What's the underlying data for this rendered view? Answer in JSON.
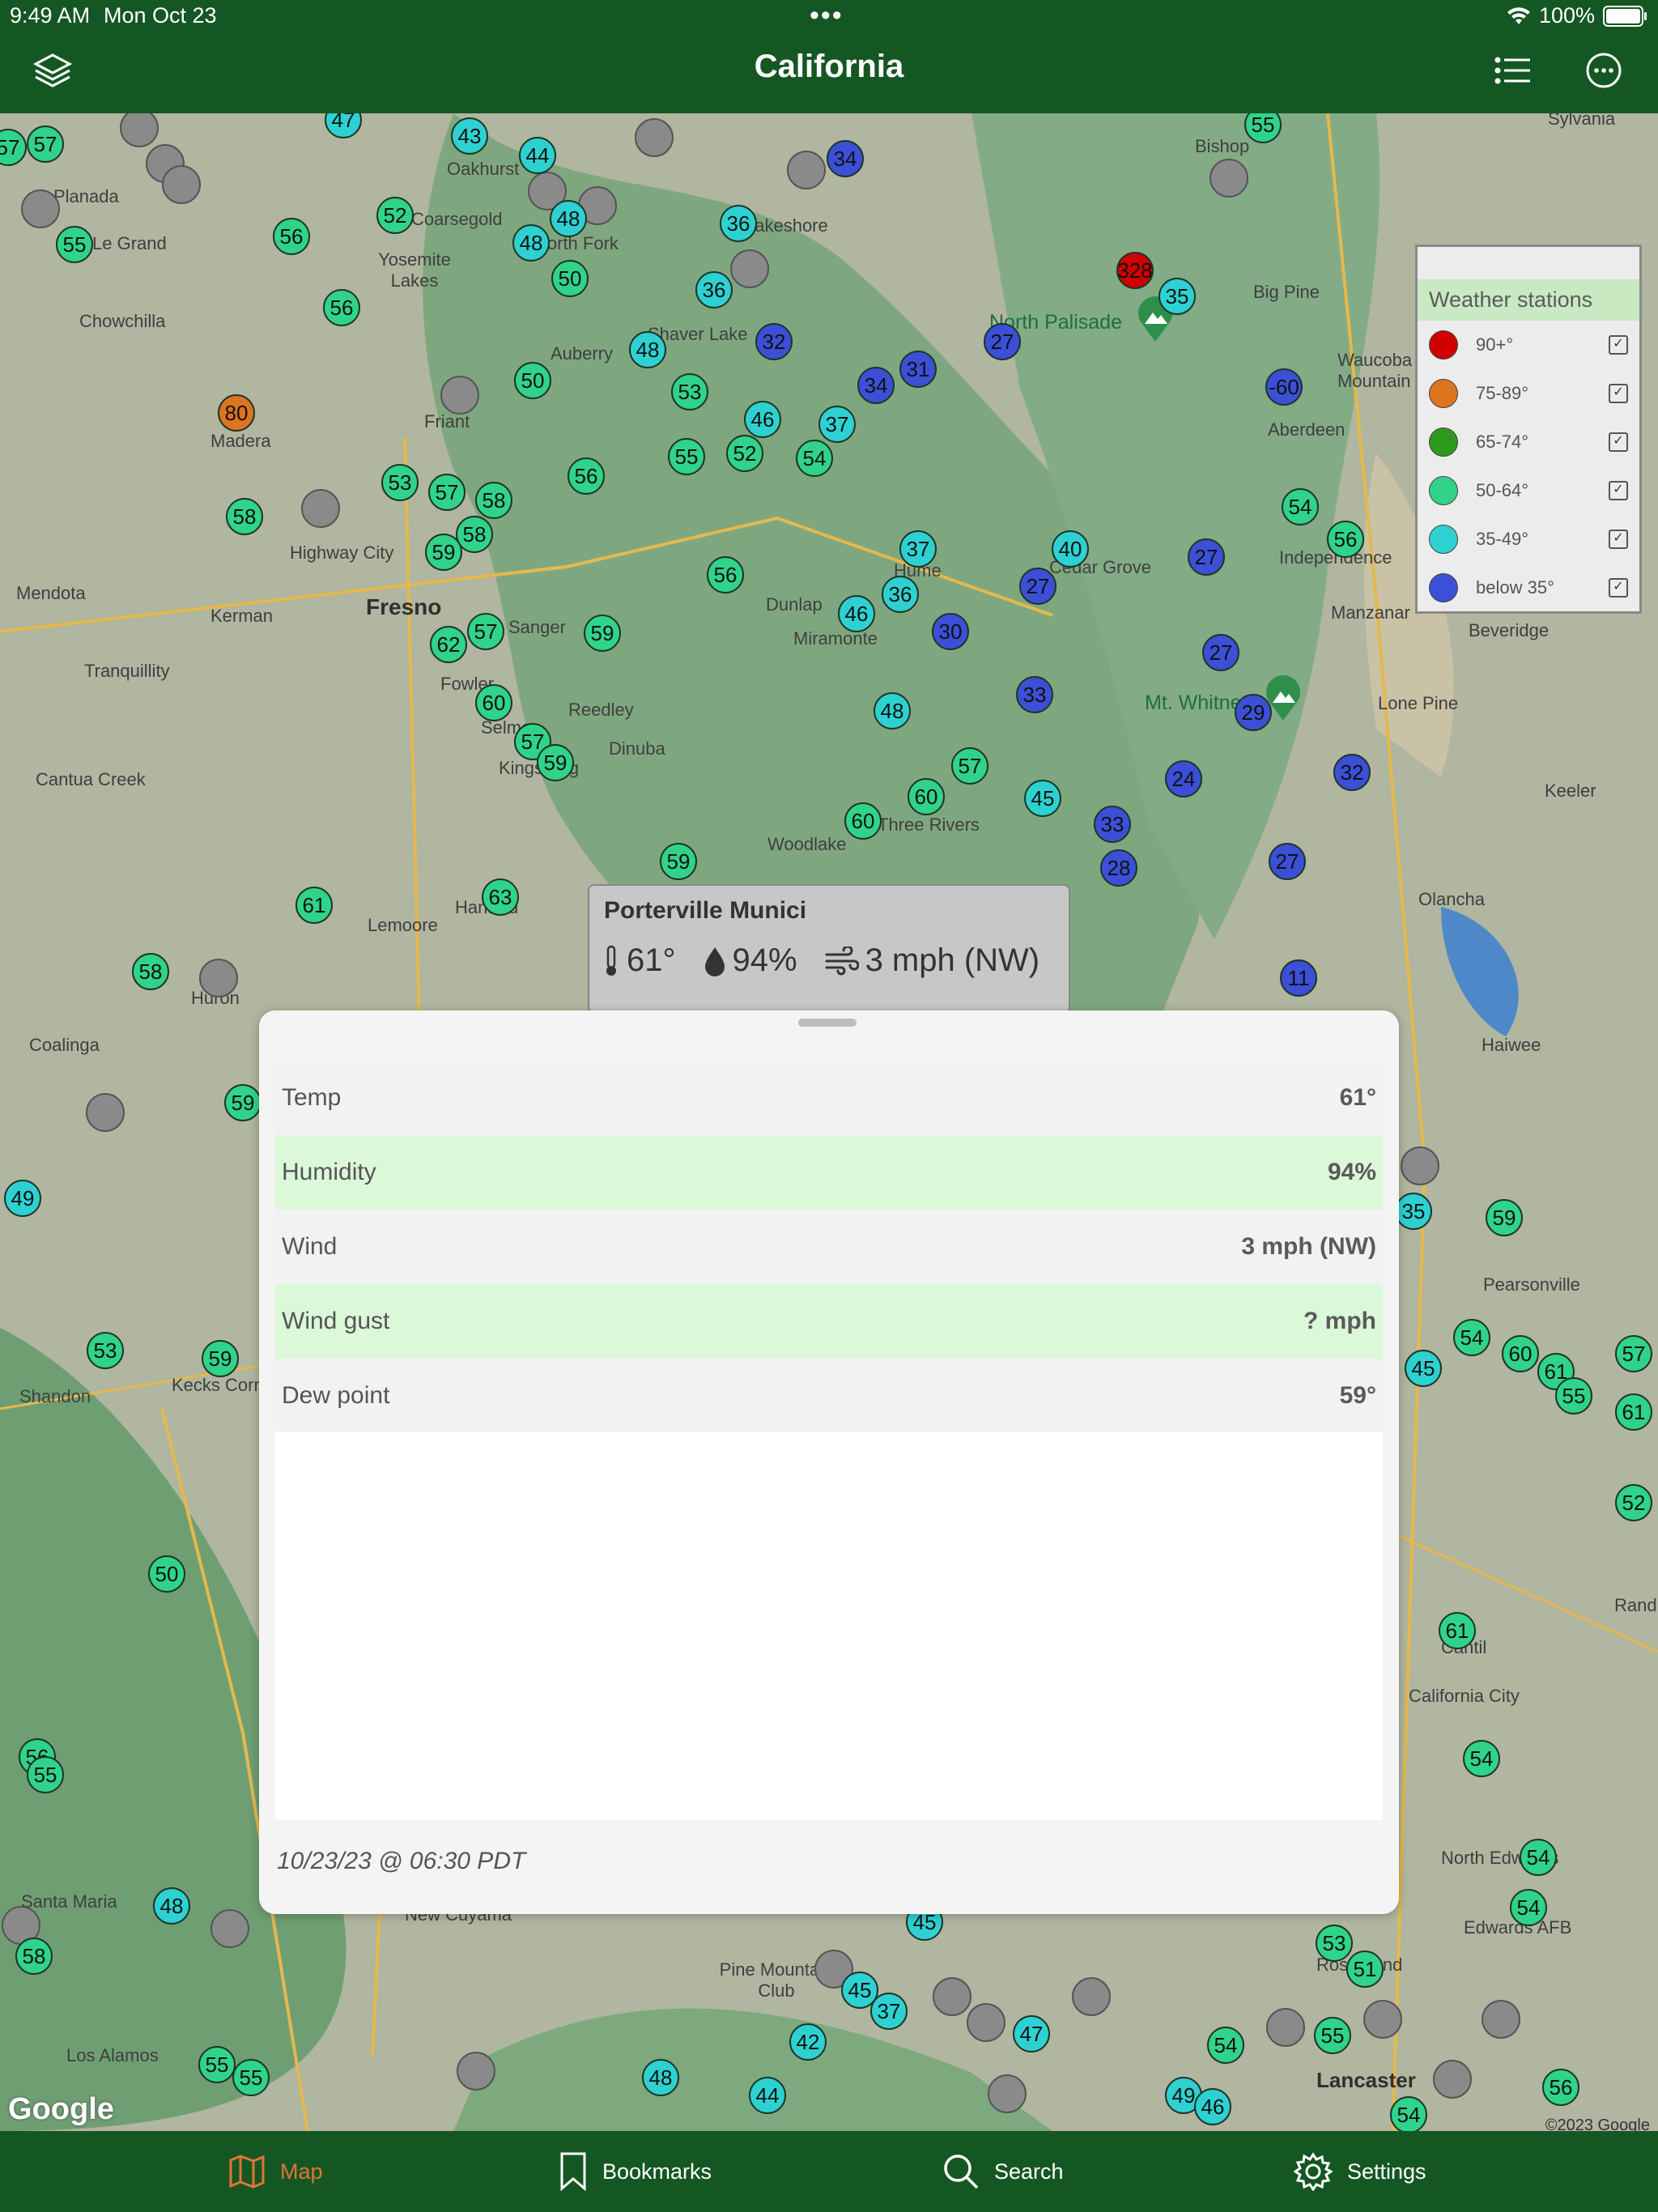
{
  "status": {
    "time": "9:49 AM",
    "date": "Mon Oct 23",
    "battery": "100%"
  },
  "nav": {
    "title": "California"
  },
  "colors": {
    "nav_bg": "#155723",
    "active_tab": "#e2733a",
    "row_alt": "#dbf8d9"
  },
  "legend": {
    "title": "Weather stations",
    "items": [
      {
        "label": "90+°",
        "color": "#d00000"
      },
      {
        "label": "75-89°",
        "color": "#dd7420"
      },
      {
        "label": "65-74°",
        "color": "#2e9a1d"
      },
      {
        "label": "50-64°",
        "color": "#30d38a"
      },
      {
        "label": "35-49°",
        "color": "#2ed1d1"
      },
      {
        "label": "below 35°",
        "color": "#3b50d6"
      }
    ]
  },
  "callout": {
    "title": "Porterville Munici",
    "temp": "61°",
    "humidity": "94%",
    "wind": "3 mph (NW)"
  },
  "sheet": {
    "rows": [
      {
        "label": "Temp",
        "value": "61°"
      },
      {
        "label": "Humidity",
        "value": "94%"
      },
      {
        "label": "Wind",
        "value": "3 mph (NW)"
      },
      {
        "label": "Wind gust",
        "value": "? mph"
      },
      {
        "label": "Dew point",
        "value": "59°"
      }
    ],
    "updated": "10/23/23 @ 06:30 PDT"
  },
  "map": {
    "places": {
      "p0": "Planada",
      "p1": "Le Grand",
      "p2": "Chowchilla",
      "p3": "Madera",
      "p4": "Coarsegold",
      "p5": "Yosemite Lakes",
      "p6": "Oakhurst",
      "p7": "Auberry",
      "p8": "Friant",
      "p9": "Highway City",
      "p10": "Fresno",
      "p11": "Kerman",
      "p12": "Mendota",
      "p13": "Tranquillity",
      "p14": "Sanger",
      "p15": "Fowler",
      "p16": "Selma",
      "p17": "Kingsburg",
      "p18": "Reedley",
      "p19": "Dinuba",
      "p20": "Cantua Creek",
      "p21": "Lemoore",
      "p22": "Hanford",
      "p23": "Huron",
      "p24": "Coalinga",
      "p25": "Dunlap",
      "p26": "Miramonte",
      "p27": "Hume",
      "p28": "Cedar Grove",
      "p29": "Woodlake",
      "p30": "Three Rivers",
      "p31": "North Palisade",
      "p32": "Big Pine",
      "p33": "Bishop",
      "p34": "Aberdeen",
      "p35": "Independence",
      "p36": "Manzanar",
      "p37": "Beveridge",
      "p38": "Mt. Whitney",
      "p39": "Lone Pine",
      "p40": "Keeler",
      "p41": "Olancha",
      "p42": "Haiwee",
      "p43": "Pearsonville",
      "p44": "Shandon",
      "p45": "Kecks Corner",
      "p46": "Rand",
      "p47": "Cantil",
      "p48": "California City",
      "p49": "North Edwards",
      "p50": "Edwards AFB",
      "p51": "Rosamond",
      "p52": "Pine Mountain Club",
      "p53": "Los Alamos",
      "p54": "Lancaster",
      "p55": "Santa Maria",
      "p56": "New Cuyama",
      "p57": "Sylvania",
      "p58": "Waucoba Mountain",
      "p59": "Shaver Lake",
      "p60": "Lakeshore",
      "p61": "North Fork",
      "p62": "Chowchilla"
    },
    "markers": [
      {
        "v": "57"
      },
      {
        "v": "57"
      },
      {
        "v": "55"
      },
      {
        "v": "56"
      },
      {
        "v": "56"
      },
      {
        "v": "52"
      },
      {
        "v": "43"
      },
      {
        "v": "44"
      },
      {
        "v": "48"
      },
      {
        "v": "48"
      },
      {
        "v": "50"
      },
      {
        "v": "36"
      },
      {
        "v": "36"
      },
      {
        "v": "32"
      },
      {
        "v": "48"
      },
      {
        "v": "50"
      },
      {
        "v": "80"
      },
      {
        "v": "53"
      },
      {
        "v": "57"
      },
      {
        "v": "58"
      },
      {
        "v": "56"
      },
      {
        "v": "58"
      },
      {
        "v": "58"
      },
      {
        "v": "59"
      },
      {
        "v": "53"
      },
      {
        "v": "46"
      },
      {
        "v": "37"
      },
      {
        "v": "55"
      },
      {
        "v": "52"
      },
      {
        "v": "54"
      },
      {
        "v": "34"
      },
      {
        "v": "31"
      },
      {
        "v": "27"
      },
      {
        "v": "34"
      },
      {
        "v": "-60"
      },
      {
        "v": "35"
      },
      {
        "v": "328"
      },
      {
        "v": "47"
      },
      {
        "v": "55"
      },
      {
        "v": "54"
      },
      {
        "v": "56"
      },
      {
        "v": "37"
      },
      {
        "v": "36"
      },
      {
        "v": "40"
      },
      {
        "v": "27"
      },
      {
        "v": "27"
      },
      {
        "v": "56"
      },
      {
        "v": "46"
      },
      {
        "v": "30"
      },
      {
        "v": "62"
      },
      {
        "v": "57"
      },
      {
        "v": "59"
      },
      {
        "v": "27"
      },
      {
        "v": "33"
      },
      {
        "v": "60"
      },
      {
        "v": "57"
      },
      {
        "v": "59"
      },
      {
        "v": "48"
      },
      {
        "v": "29"
      },
      {
        "v": "32"
      },
      {
        "v": "24"
      },
      {
        "v": "57"
      },
      {
        "v": "60"
      },
      {
        "v": "45"
      },
      {
        "v": "60"
      },
      {
        "v": "59"
      },
      {
        "v": "33"
      },
      {
        "v": "28"
      },
      {
        "v": "27"
      },
      {
        "v": "63"
      },
      {
        "v": "61"
      },
      {
        "v": "58"
      },
      {
        "v": "11"
      },
      {
        "v": "59"
      },
      {
        "v": "49"
      },
      {
        "v": "35"
      },
      {
        "v": "59"
      },
      {
        "v": "53"
      },
      {
        "v": "59"
      },
      {
        "v": "54"
      },
      {
        "v": "60"
      },
      {
        "v": "45"
      },
      {
        "v": "61"
      },
      {
        "v": "55"
      },
      {
        "v": "57"
      },
      {
        "v": "61"
      },
      {
        "v": "52"
      },
      {
        "v": "50"
      },
      {
        "v": "61"
      },
      {
        "v": "54"
      },
      {
        "v": "54"
      },
      {
        "v": "54"
      },
      {
        "v": "53"
      },
      {
        "v": "51"
      },
      {
        "v": "56"
      },
      {
        "v": "55"
      },
      {
        "v": "48"
      },
      {
        "v": "58"
      },
      {
        "v": "45"
      },
      {
        "v": "45"
      },
      {
        "v": "37"
      },
      {
        "v": "42"
      },
      {
        "v": "47"
      },
      {
        "v": "48"
      },
      {
        "v": "44"
      },
      {
        "v": "55"
      },
      {
        "v": "55"
      },
      {
        "v": "54"
      },
      {
        "v": "55"
      },
      {
        "v": "49"
      },
      {
        "v": "46"
      },
      {
        "v": "54"
      },
      {
        "v": "56"
      }
    ],
    "google": "Google",
    "copyright": "©2023 Google"
  },
  "tabs": [
    {
      "label": "Map",
      "icon": "map-icon"
    },
    {
      "label": "Bookmarks",
      "icon": "bookmark-icon"
    },
    {
      "label": "Search",
      "icon": "search-icon"
    },
    {
      "label": "Settings",
      "icon": "settings-icon"
    }
  ]
}
